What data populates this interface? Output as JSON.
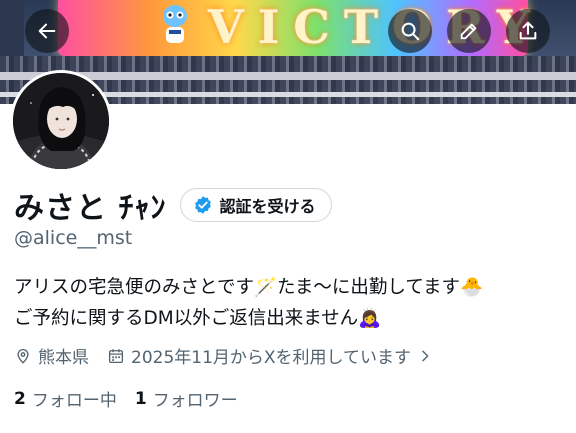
{
  "banner": {
    "board_text": "VICTORY"
  },
  "profile": {
    "display_name": "みさと ﾁｬﾝ",
    "verify_label": "認証を受ける",
    "handle": "@alice__mst",
    "bio_line1": "アリスの宅急便のみさとです🪄たま〜に出勤してます🐣",
    "bio_line2": "ご予約に関するDM以外ご返信出来ません🙇‍♀️",
    "location": "熊本県",
    "joined": "2025年11月からXを利用しています"
  },
  "stats": {
    "following_count": "2",
    "following_label": "フォロー中",
    "followers_count": "1",
    "followers_label": "フォロワー"
  },
  "icons": {
    "back": "arrow-left-icon",
    "search": "search-icon",
    "edit": "pencil-icon",
    "share": "share-icon",
    "verified": "verified-badge-icon",
    "location": "location-pin-icon",
    "calendar": "calendar-icon",
    "chevron": "chevron-right-icon"
  },
  "colors": {
    "verified_blue": "#1d9bf0",
    "secondary_text": "#536471",
    "primary_text": "#0f1419"
  }
}
